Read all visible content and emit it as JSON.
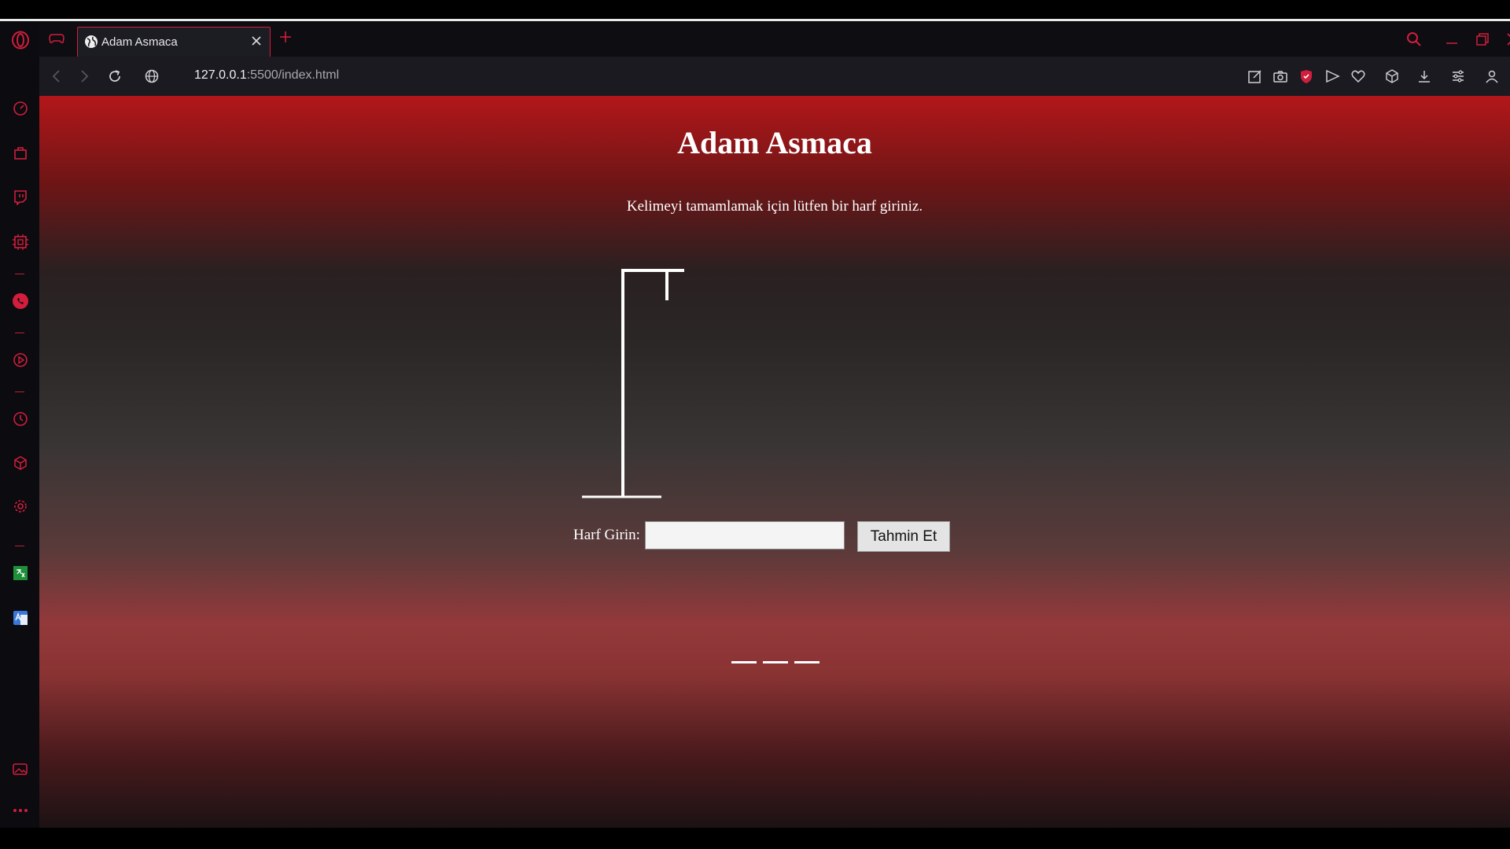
{
  "browser": {
    "tab": {
      "title": "Adam Asmaca"
    },
    "address": {
      "host": "127.0.0.1",
      "path": ":5500/index.html"
    }
  },
  "game": {
    "title": "Adam Asmaca",
    "instruction": "Kelimeyi tamamlamak için lütfen bir harf giriniz.",
    "input_label": "Harf Girin:",
    "input_value": "",
    "button_label": "Tahmin Et",
    "blanks": [
      "",
      "",
      ""
    ]
  },
  "colors": {
    "accent": "#d21e3c",
    "gradient_top": "#b3171a",
    "gradient_mid": "#2b2727",
    "gradient_low": "#93393b"
  },
  "icons": {
    "sidebar": [
      "opera-logo-icon",
      "speed-dial-icon",
      "shopping-bag-icon",
      "twitch-icon",
      "cpu-icon",
      "whatsapp-icon",
      "player-icon",
      "history-icon",
      "cube-icon",
      "settings-icon",
      "translate-icon",
      "google-translate-icon",
      "gallery-icon",
      "more-icon"
    ],
    "toolbar": [
      "snapshot-edit-icon",
      "camera-icon",
      "vpn-shield-icon",
      "send-icon",
      "heart-icon",
      "extensions-icon",
      "download-icon",
      "easy-setup-icon",
      "profile-icon"
    ]
  }
}
